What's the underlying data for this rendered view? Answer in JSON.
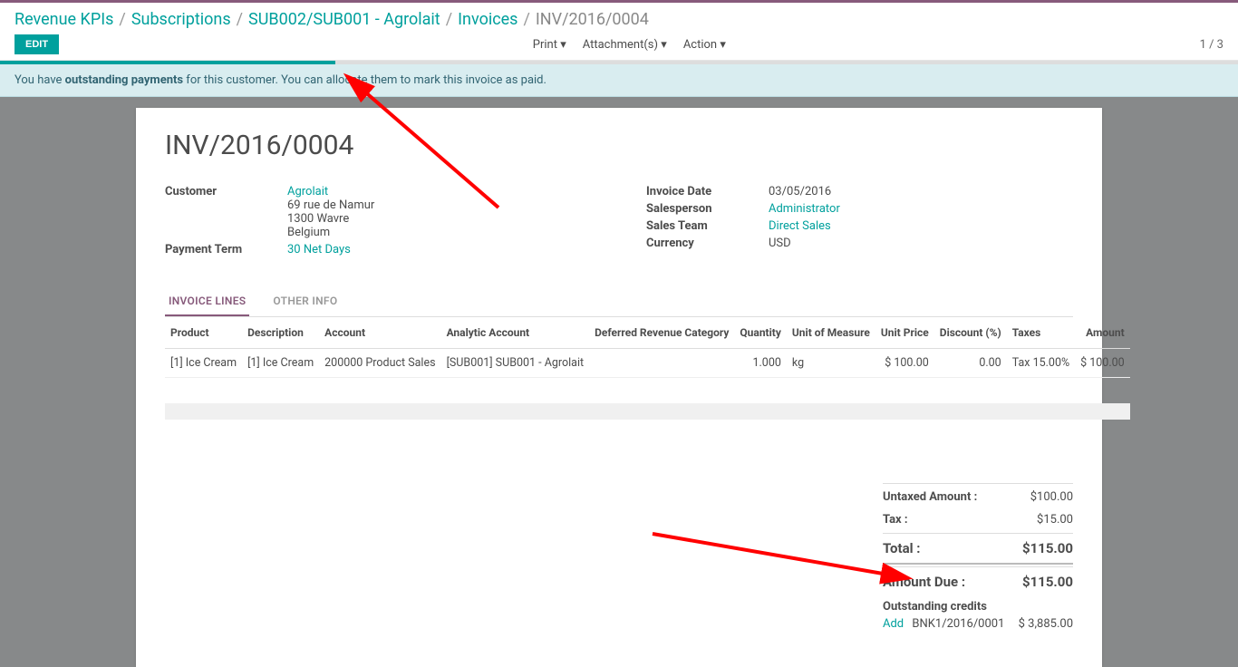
{
  "breadcrumb": {
    "revenue_kpis": "Revenue KPIs",
    "subscriptions": "Subscriptions",
    "sub_ref": "SUB002/SUB001 - Agrolait",
    "invoices": "Invoices",
    "current": "INV/2016/0004"
  },
  "toolbar": {
    "edit": "EDIT",
    "print": "Print",
    "attachments": "Attachment(s)",
    "action": "Action",
    "pager": "1 / 3"
  },
  "notice": {
    "pre": "You have ",
    "strong": "outstanding payments",
    "post": " for this customer. You can allocate them to mark this invoice as paid."
  },
  "invoice": {
    "title": "INV/2016/0004",
    "customer_label": "Customer",
    "customer_name": "Agrolait",
    "customer_street": "69 rue de Namur",
    "customer_city": "1300 Wavre",
    "customer_country": "Belgium",
    "payment_term_label": "Payment Term",
    "payment_term": "30 Net Days",
    "invoice_date_label": "Invoice Date",
    "invoice_date": "03/05/2016",
    "salesperson_label": "Salesperson",
    "salesperson": "Administrator",
    "sales_team_label": "Sales Team",
    "sales_team": "Direct Sales",
    "currency_label": "Currency",
    "currency": "USD"
  },
  "tabs": {
    "lines": "INVOICE LINES",
    "other": "OTHER INFO"
  },
  "columns": {
    "product": "Product",
    "description": "Description",
    "account": "Account",
    "analytic": "Analytic Account",
    "deferred": "Deferred Revenue Category",
    "qty": "Quantity",
    "uom": "Unit of Measure",
    "unit_price": "Unit Price",
    "discount": "Discount (%)",
    "taxes": "Taxes",
    "amount": "Amount"
  },
  "lines": [
    {
      "product": "[1] Ice Cream",
      "description": "[1] Ice Cream",
      "account": "200000 Product Sales",
      "analytic": "[SUB001] SUB001 - Agrolait",
      "deferred": "",
      "qty": "1.000",
      "uom": "kg",
      "unit_price": "$ 100.00",
      "discount": "0.00",
      "taxes": "Tax 15.00%",
      "amount": "$ 100.00"
    }
  ],
  "totals": {
    "untaxed_label": "Untaxed Amount :",
    "untaxed": "$100.00",
    "tax_label": "Tax :",
    "tax": "$15.00",
    "total_label": "Total :",
    "total": "$115.00",
    "due_label": "Amount Due :",
    "due": "$115.00"
  },
  "outstanding": {
    "title": "Outstanding credits",
    "add": "Add",
    "ref": "BNK1/2016/0001",
    "amount": "$ 3,885.00"
  }
}
